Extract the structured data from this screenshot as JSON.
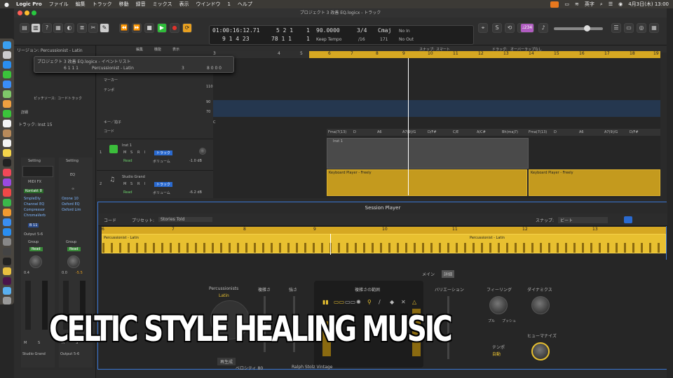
{
  "menubar": {
    "apple": "",
    "app": "Logic Pro",
    "items": [
      "ファイル",
      "編集",
      "トラック",
      "移動",
      "録音",
      "ミックス",
      "表示",
      "ウインドウ",
      "1",
      "ヘルプ"
    ],
    "input_mode": "英字",
    "datetime": "4月3日(木) 13:00"
  },
  "window": {
    "title": "プロジェクト 3 改善 EQ.logicx - トラック"
  },
  "lcd": {
    "timecode": "01:00:16:12.71",
    "position": "9 1 4 23",
    "bar_beat_top": "5 2 1",
    "bar_beat_bottom": "78 1 1",
    "pos_top_sub": "1",
    "pos_bot_sub": "1",
    "tempo": "90.0000",
    "tempo_mode": "Keep Tempo",
    "signature": "3/4",
    "division": "/16",
    "key": "Cmaj",
    "key_num": "171",
    "midi_in": "No In",
    "midi_out": "No Out"
  },
  "toolbar": {
    "count_in": "♩234"
  },
  "region_inspector": {
    "label": "リージョン:",
    "name": "Percussionist - Latin",
    "pitch_source_label": "ピッチソース:",
    "pitch_source": "コードトラック",
    "detail": "詳細",
    "track_label": "トラック:",
    "track_name": "Inst 15"
  },
  "strips": [
    {
      "setting": "Setting",
      "eq": "EQ",
      "midi_fx": "MIDI FX",
      "instrument": "Kontakt 8",
      "plugins": [
        "SmpleDly",
        "Channel EQ",
        "Compressor",
        "ChromaVerb"
      ],
      "send": "B 11",
      "output": "Output 5-6",
      "group": "Group",
      "automation": "Read",
      "volume": "0.4",
      "name": "Studio Grand",
      "mute": "M",
      "solo": "S"
    },
    {
      "setting": "Setting",
      "eq": "EQ",
      "plugins": [
        "Ozone 10",
        "Oxford EQ",
        "Oxford Lim"
      ],
      "output": "",
      "group": "Group",
      "automation": "Read",
      "volume": "0.0",
      "pan": "-5.5",
      "name": "Output 5-6",
      "mute": "M",
      "solo": "S"
    }
  ],
  "tracks_header": {
    "edit": "編集",
    "function": "機能",
    "view": "表示",
    "snap_label": "スナップ:",
    "snap": "スマート",
    "drag_label": "ドラッグ:",
    "drag": "オーバーラップなし"
  },
  "ruler": [
    "3",
    "4",
    "5",
    "6",
    "7",
    "8",
    "9",
    "10",
    "11",
    "12",
    "13",
    "14",
    "15",
    "16",
    "17",
    "18",
    "19"
  ],
  "global_tracks": {
    "marker": "マーカー",
    "tempo": "テンポ",
    "tempo_values": [
      "110",
      "90",
      "70"
    ],
    "key_sig": "キー／拍子",
    "key_value": "C",
    "chord": "コード",
    "chords": [
      "Fma(7(13)",
      "D",
      "A6",
      "A7(9)/G",
      "D/F#",
      "C/E",
      "A/C#",
      "Bh(maj7)",
      "Fma(7(13)",
      "D",
      "A6",
      "A7(9)/G",
      "D/F#"
    ]
  },
  "tracks": [
    {
      "num": "1",
      "name": "Inst 1",
      "m": "M",
      "s": "S",
      "r": "R",
      "i": "I",
      "btn": "トラック",
      "automation": "Read",
      "param": "ボリューム",
      "value": "-1.0 dB",
      "region": "Inst 1"
    },
    {
      "num": "2",
      "name": "Studio Grand",
      "m": "M",
      "s": "S",
      "r": "R",
      "i": "I",
      "btn": "トラック",
      "automation": "Read",
      "param": "ボリューム",
      "value": "-6.2 dB",
      "region1": "Keyboard Player - Freely",
      "region2": "Keyboard Player - Freely"
    }
  ],
  "event_list": {
    "title": "プロジェクト 3 改善 EQ.logicx - イベントリスト",
    "position": "6 1 1 1",
    "name": "Percussionist - Latin",
    "value1": "3",
    "value2": "8 0 0 0"
  },
  "session_player": {
    "title": "Session Player",
    "chord_btn": "コード",
    "preset_label": "プリセット:",
    "preset": "Stories Told",
    "snap_label": "スナップ:",
    "snap": "ビート",
    "ruler": [
      "6",
      "7",
      "8",
      "9",
      "10",
      "11",
      "12",
      "13"
    ],
    "region1": "Percussionist - Latin",
    "region2": "Percussionist - Latin",
    "tab_main": "メイン",
    "tab_detail": "詳細",
    "player": "Percussionists",
    "style": "Latin",
    "complexity": "複雑さ",
    "intensity": "強さ",
    "complexity_range": "複雑さの範囲",
    "variation": "バリエーション",
    "feel": "フィーリング",
    "feel_left": "プル",
    "feel_right": "プッシュ",
    "dynamics": "ダイナミクス",
    "humanize": "ヒューマナイズ",
    "tempo": "テンポ",
    "tempo_value": "自動",
    "regenerate": "再生成",
    "velocity": "ベロシティ 80",
    "footer": "Ralph Stolz Vintage"
  },
  "overlay_text": "CELTIC STYLE HEALING MUSIC",
  "colors": {
    "accent": "#3a78d6",
    "region_gold": "#d6a822",
    "play_green": "#2fbb3a",
    "record_red": "#e0332c",
    "cycle_orange": "#e8a020",
    "count_in_purple": "#b05cc0"
  }
}
